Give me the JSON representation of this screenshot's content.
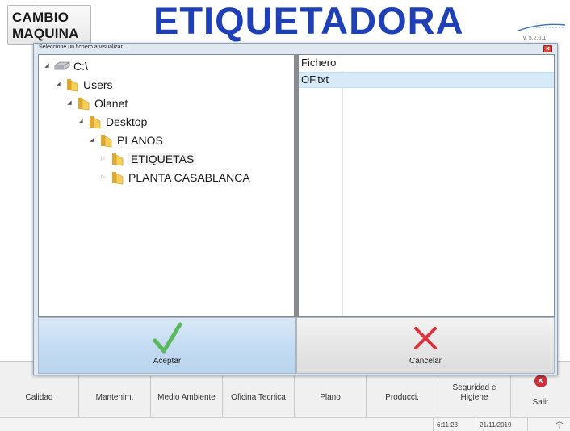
{
  "header": {
    "cambio_line1": "CAMBIO",
    "cambio_line2": "MAQUINA",
    "title": "ETIQUETADORA",
    "version": "v. 5.2.0.1"
  },
  "dialog": {
    "title": "Seleccione un fichero a visualizar...",
    "tree": [
      {
        "label": "C:\\",
        "icon": "drive-icon",
        "expanded": true
      },
      {
        "label": "Users",
        "icon": "folder-icon",
        "expanded": true
      },
      {
        "label": "Olanet",
        "icon": "folder-icon",
        "expanded": true
      },
      {
        "label": "Desktop",
        "icon": "folder-icon",
        "expanded": true
      },
      {
        "label": "PLANOS",
        "icon": "folder-icon",
        "expanded": true
      },
      {
        "label": "ETIQUETAS",
        "icon": "folder-icon",
        "expanded": false,
        "selected": true
      },
      {
        "label": "PLANTA CASABLANCA",
        "icon": "folder-icon",
        "expanded": false
      }
    ],
    "file_list": {
      "column_header": "Fichero",
      "files": [
        "OF.txt"
      ]
    },
    "accept_label": "Aceptar",
    "cancel_label": "Cancelar"
  },
  "toolbar": {
    "items": [
      "Calidad",
      "Mantenim.",
      "Medio Ambiente",
      "Oficina Tecnica",
      "Plano",
      "Producci."
    ],
    "seguridad_line1": "Seguridad e",
    "seguridad_line2": "Higiene",
    "salir": "Salir"
  },
  "status": {
    "time": "6:11:23",
    "date": "21/11/2019"
  },
  "colors": {
    "title": "#1e3fb5",
    "accept_check": "#5cb85c",
    "cancel_x": "#d9343f",
    "selected_row": "#d7eaf8"
  }
}
